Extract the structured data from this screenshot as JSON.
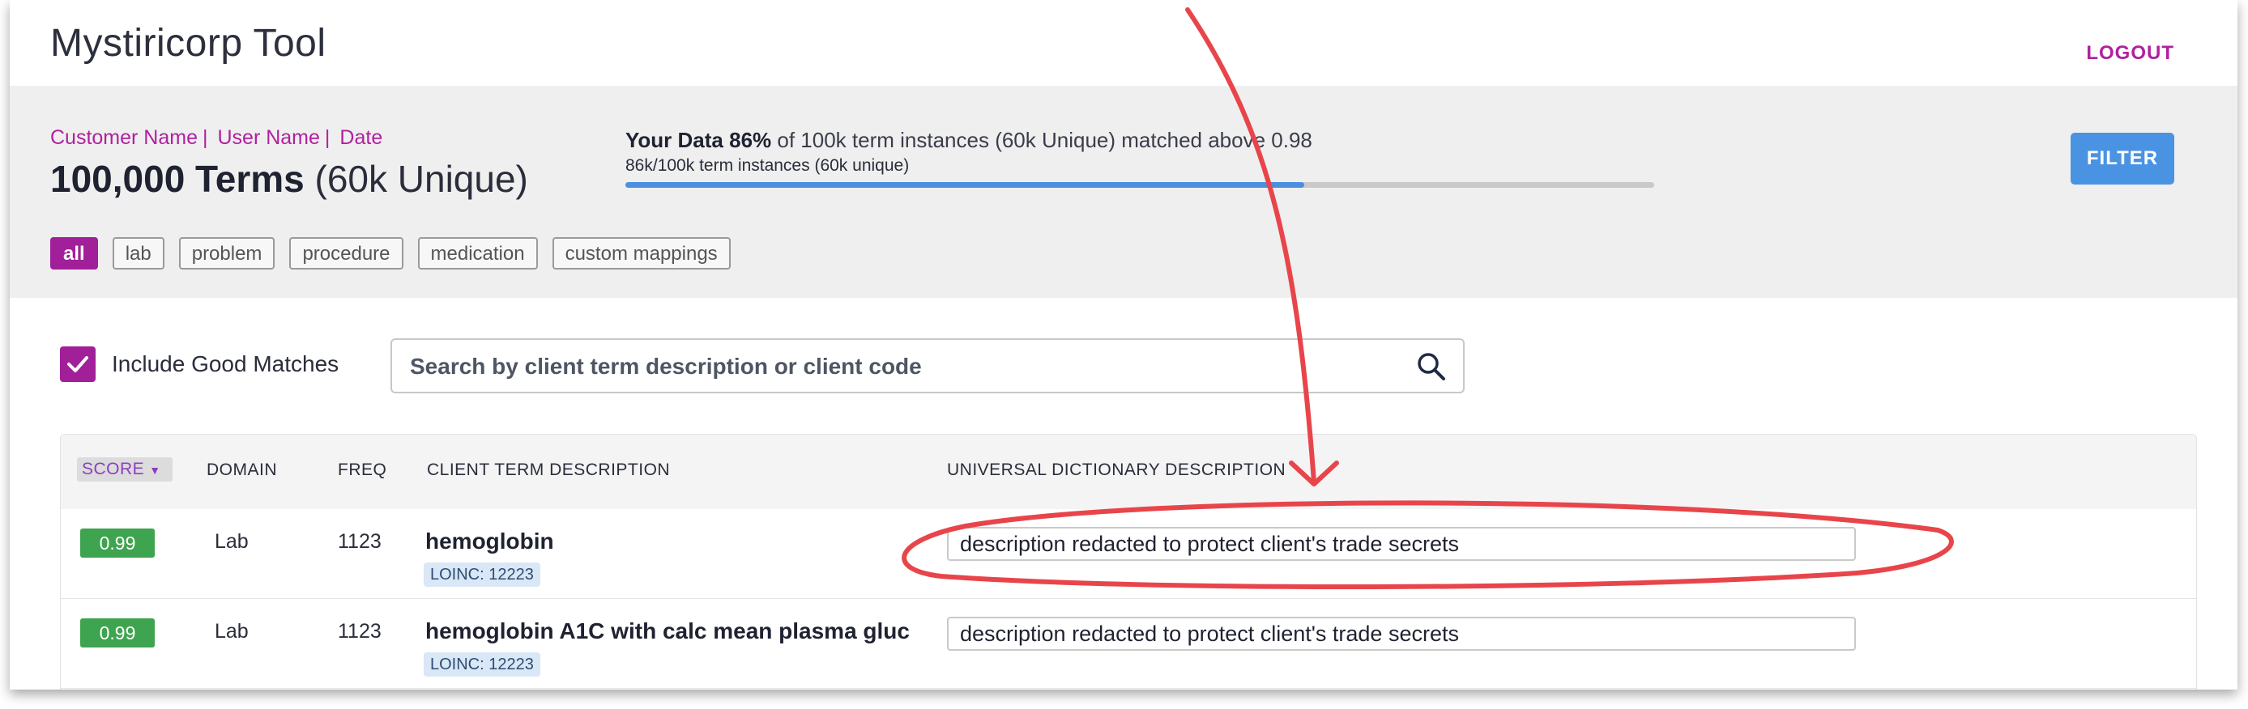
{
  "app": {
    "title": "Mystiricorp Tool",
    "logout_label": "LOGOUT"
  },
  "summary": {
    "customer_label": "Customer Name",
    "user_label": "User Name",
    "date_label": "Date",
    "separator": "|",
    "terms_count": "100,000 Terms",
    "terms_unique": "(60k Unique)",
    "your_data_label": "Your Data",
    "match_percent": "86%",
    "match_text": "of 100k term instances (60k Unique)  matched above 0.98",
    "progress_caption": "86k/100k term instances (60k unique)",
    "progress_fraction": 0.66,
    "filter_label": "FILTER",
    "filter_chips": [
      {
        "label": "all",
        "active": true
      },
      {
        "label": "lab",
        "active": false
      },
      {
        "label": "problem",
        "active": false
      },
      {
        "label": "procedure",
        "active": false
      },
      {
        "label": "medication",
        "active": false
      },
      {
        "label": "custom mappings",
        "active": false
      }
    ]
  },
  "search": {
    "include_good_matches_label": "Include Good Matches",
    "include_good_matches_checked": true,
    "placeholder": "Search by client term description or client code",
    "value": ""
  },
  "table": {
    "columns": {
      "score": "SCORE",
      "domain": "DOMAIN",
      "freq": "FREQ",
      "client_term": "CLIENT TERM DESCRIPTION",
      "universal": "UNIVERSAL DICTIONARY DESCRIPTION"
    },
    "rows": [
      {
        "score": "0.99",
        "domain": "Lab",
        "freq": "1123",
        "term": "hemoglobin",
        "code": "LOINC: 12223",
        "universal_description": "description redacted to protect client's trade secrets"
      },
      {
        "score": "0.99",
        "domain": "Lab",
        "freq": "1123",
        "term": "hemoglobin A1C with calc mean plasma gluc",
        "code": "LOINC: 12223",
        "universal_description": "description redacted to protect client's trade secrets"
      }
    ]
  },
  "colors": {
    "brand_magenta": "#a21f9a",
    "filter_blue": "#4a93e3",
    "score_green": "#3fa450",
    "annotation_red": "#e8454b"
  },
  "icons": {
    "search": "search-icon",
    "checkbox": "check-icon",
    "sort": "sort-caret-down-icon"
  }
}
